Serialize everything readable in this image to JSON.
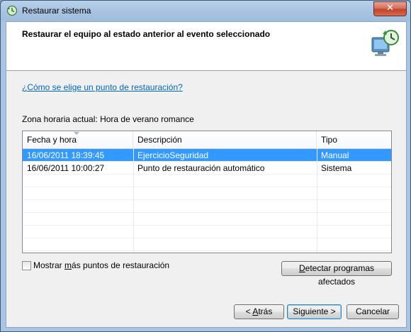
{
  "window": {
    "title": "Restaurar sistema",
    "close_symbol": "✕"
  },
  "header": {
    "title": "Restaurar el equipo al estado anterior al evento seleccionado"
  },
  "help_link": "¿Cómo se elige un punto de restauración?",
  "timezone_label": "Zona horaria actual: Hora de verano romance",
  "table": {
    "columns": [
      "Fecha y hora",
      "Descripción",
      "Tipo"
    ],
    "rows": [
      {
        "date": "16/06/2011 18:39:45",
        "description": "EjercicioSeguridad",
        "type": "Manual",
        "selected": true
      },
      {
        "date": "16/06/2011 10:00:27",
        "description": "Punto de restauración automático",
        "type": "Sistema",
        "selected": false
      }
    ]
  },
  "show_more": {
    "pre": "Mostrar ",
    "accel": "m",
    "post": "ás puntos de restauración",
    "checked": false
  },
  "buttons": {
    "detect": {
      "accel": "D",
      "rest": "etectar programas afectados"
    },
    "back": {
      "pre": "< ",
      "accel": "A",
      "rest": "trás"
    },
    "next": {
      "label": "Siguiente >"
    },
    "cancel": {
      "label": "Cancelar"
    }
  },
  "colors": {
    "selection": "#3399ff",
    "link": "#0066cc",
    "titlebar": "#a9c4e2"
  },
  "icons": {
    "title": "system-restore-icon",
    "header": "system-restore-large-icon"
  }
}
